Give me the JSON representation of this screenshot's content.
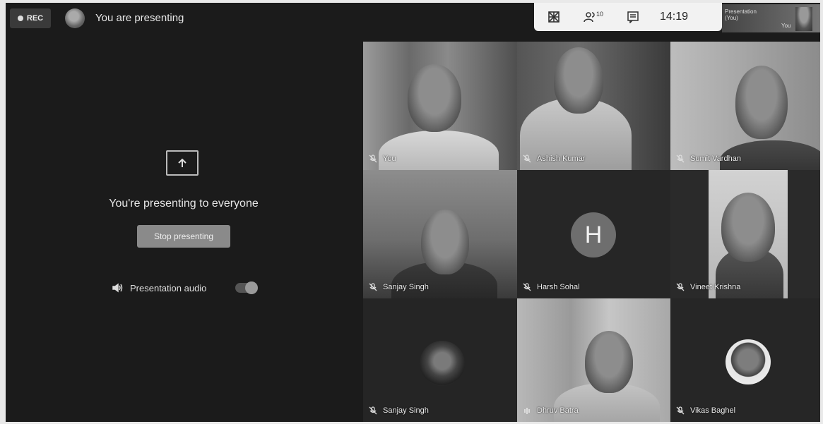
{
  "top_bar": {
    "rec_label": "REC",
    "presenting_title": "You are presenting",
    "clock": "14:19",
    "participant_count": "10",
    "pip_label_line1": "Presentation",
    "pip_label_line2": "(You)",
    "pip_you": "You"
  },
  "presenting_panel": {
    "heading": "You're presenting to everyone",
    "stop_button": "Stop presenting",
    "audio_label": "Presentation audio"
  },
  "participants": [
    {
      "name": "You"
    },
    {
      "name": "Ashish Kumar"
    },
    {
      "name": "Sumit Vardhan"
    },
    {
      "name": "Sanjay Singh"
    },
    {
      "name": "Harsh Sohal",
      "initial": "H"
    },
    {
      "name": "Vineet Krishna"
    },
    {
      "name": "Sanjay Singh"
    },
    {
      "name": "Dhruv Batra"
    },
    {
      "name": "Vikas Baghel"
    }
  ],
  "colors": {
    "background": "#1b1b1b",
    "control_bar": "#f2f2f2",
    "tile_dark": "#2a2a2a"
  }
}
